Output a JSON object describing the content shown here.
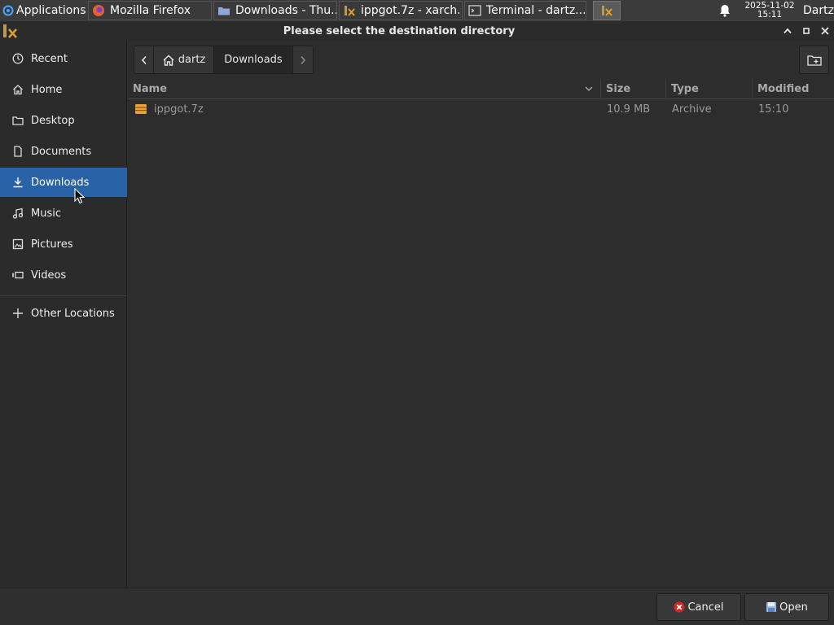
{
  "taskbar": {
    "applications_label": "Applications",
    "tasks": [
      {
        "label": "Mozilla Firefox",
        "icon": "firefox-icon"
      },
      {
        "label": "Downloads - Thu...",
        "icon": "folder-icon"
      },
      {
        "label": "ippgot.7z - xarch...",
        "icon": "xarchiver-icon"
      },
      {
        "label": "Terminal - dartz...",
        "icon": "terminal-icon"
      },
      {
        "label": "",
        "icon": "xarchiver-icon"
      }
    ],
    "clock_date": "2025-11-02",
    "clock_time": "15:11",
    "user": "Dartz"
  },
  "dialog": {
    "title": "Please select the destination directory"
  },
  "sidebar": {
    "items": [
      {
        "label": "Recent",
        "icon": "recent-icon"
      },
      {
        "label": "Home",
        "icon": "home-icon"
      },
      {
        "label": "Desktop",
        "icon": "desktop-folder-icon"
      },
      {
        "label": "Documents",
        "icon": "documents-icon"
      },
      {
        "label": "Downloads",
        "icon": "download-icon",
        "active": true
      },
      {
        "label": "Music",
        "icon": "music-icon"
      },
      {
        "label": "Pictures",
        "icon": "pictures-icon"
      },
      {
        "label": "Videos",
        "icon": "videos-icon"
      },
      {
        "label": "Other Locations",
        "icon": "plus-icon"
      }
    ]
  },
  "pathbar": {
    "home_label": "dartz",
    "current_label": "Downloads"
  },
  "columns": {
    "name": "Name",
    "size": "Size",
    "type": "Type",
    "modified": "Modified"
  },
  "files": [
    {
      "name": "ippgot.7z",
      "size": "10.9 MB",
      "type": "Archive",
      "modified": "15:10"
    }
  ],
  "buttons": {
    "cancel": "Cancel",
    "open": "Open"
  },
  "colors": {
    "accent": "#2a62a8",
    "background": "#2d2d2d"
  }
}
